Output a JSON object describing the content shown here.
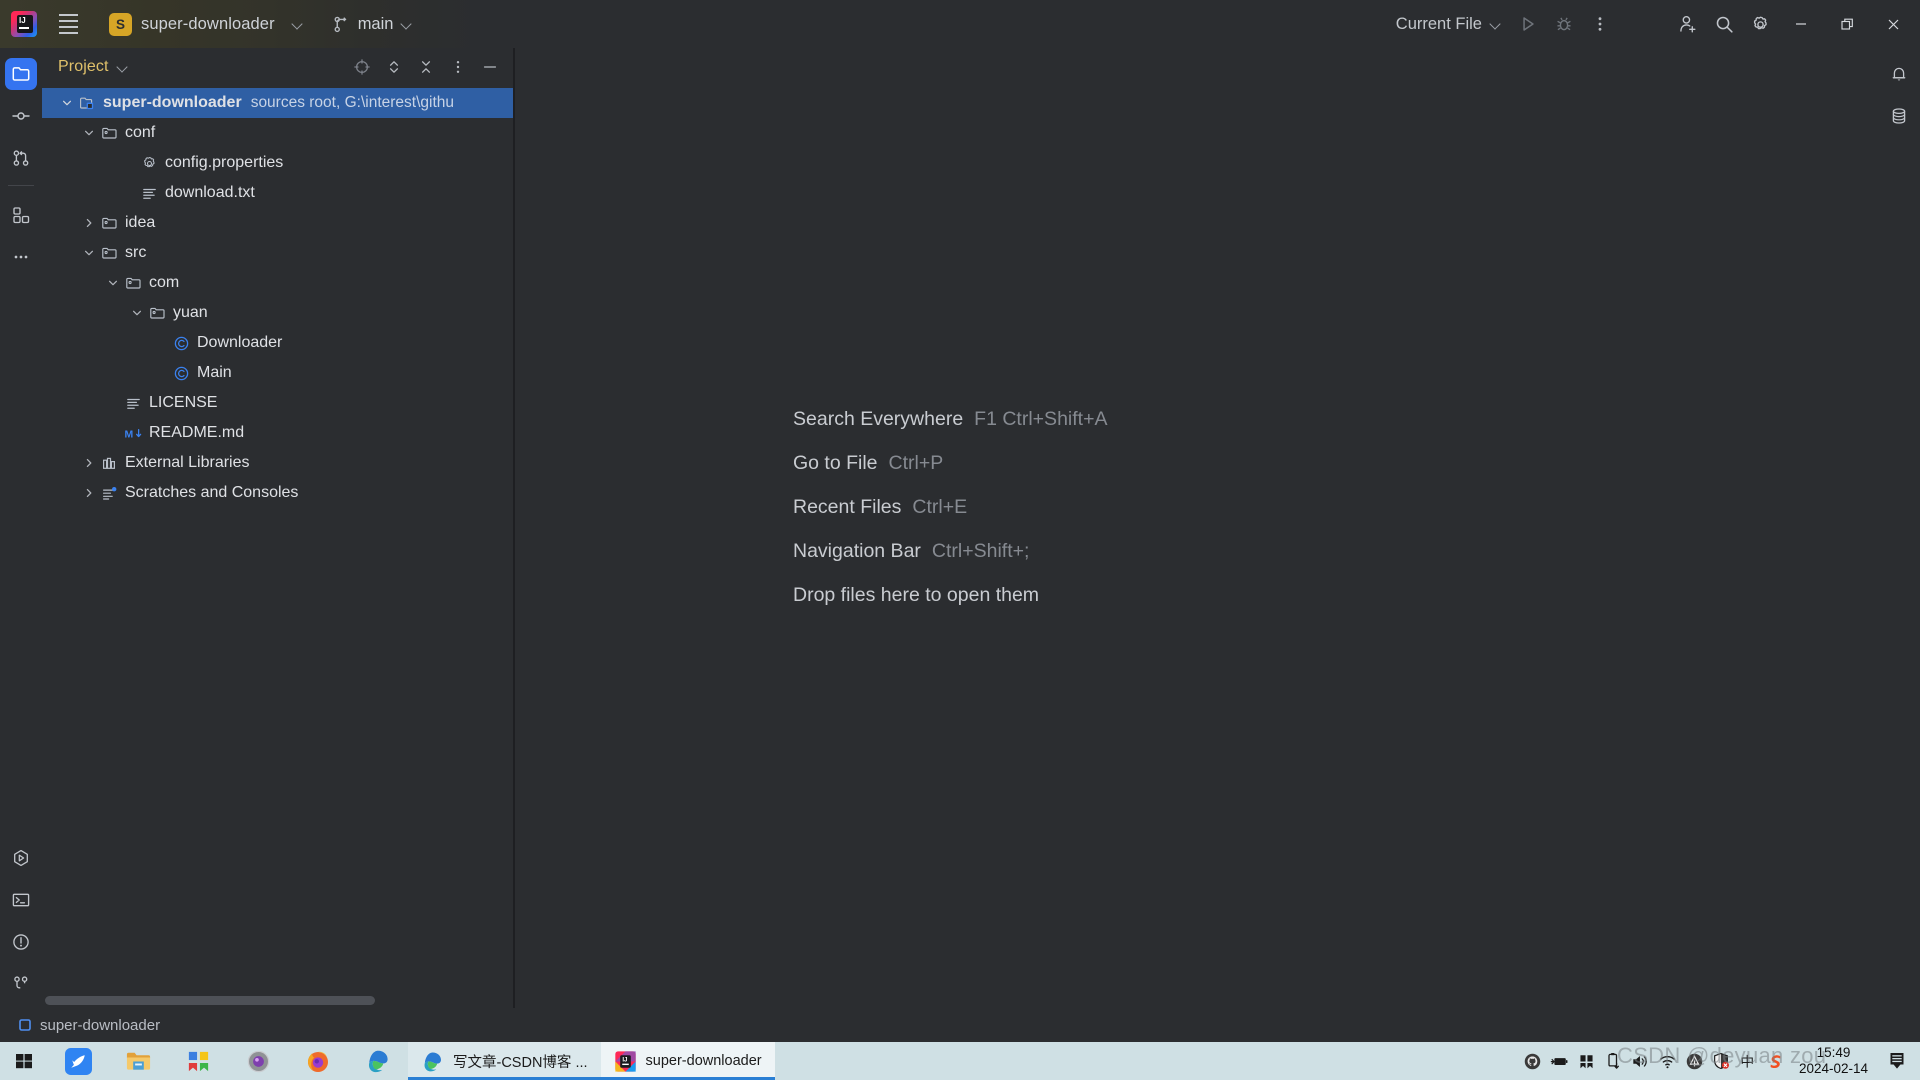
{
  "titlebar": {
    "logo_icon": "intellij-idea-logo",
    "menu_icon": "hamburger-menu-icon",
    "project_badge": "S",
    "project_name": "super-downloader",
    "project_chevron_icon": "chevron-down-icon",
    "branch_icon": "git-branch-icon",
    "branch_name": "main",
    "branch_chevron_icon": "chevron-down-icon",
    "run_config": "Current File",
    "run_config_chevron_icon": "chevron-down-icon",
    "run_icon": "run-play-icon",
    "debug_icon": "debug-bug-icon",
    "more_icon": "more-vertical-icon",
    "account_icon": "user-add-icon",
    "search_icon": "search-icon",
    "settings_icon": "gear-icon",
    "minimize_icon": "minimize-icon",
    "maximize_icon": "maximize-restore-icon",
    "close_icon": "close-icon"
  },
  "left_toolbar": {
    "items": [
      {
        "name": "project",
        "icon": "folder-icon",
        "selected": true
      },
      {
        "name": "commit",
        "icon": "commit-icon",
        "selected": false
      },
      {
        "name": "pull-requests",
        "icon": "pull-request-icon",
        "selected": false
      },
      {
        "name": "plugins",
        "icon": "squares-icon",
        "selected": false
      },
      {
        "name": "more-tool-windows",
        "icon": "more-horizontal-icon",
        "selected": false
      }
    ],
    "bottom_items": [
      {
        "name": "run",
        "icon": "run-hexagon-icon"
      },
      {
        "name": "terminal",
        "icon": "terminal-icon"
      },
      {
        "name": "problems",
        "icon": "warning-circle-icon"
      },
      {
        "name": "version-control",
        "icon": "git-branch-icon"
      }
    ]
  },
  "right_toolbar": {
    "items": [
      {
        "name": "notifications",
        "icon": "bell-icon"
      },
      {
        "name": "database",
        "icon": "database-icon"
      }
    ]
  },
  "project_panel": {
    "title": "Project",
    "title_chevron_icon": "chevron-down-icon",
    "actions": [
      {
        "name": "select-opened-file",
        "icon": "crosshair-icon"
      },
      {
        "name": "expand-collapse",
        "icon": "up-down-arrows-icon"
      },
      {
        "name": "collapse-all",
        "icon": "collapse-all-icon"
      },
      {
        "name": "options-menu",
        "icon": "more-vertical-icon"
      },
      {
        "name": "hide-panel",
        "icon": "minus-icon"
      }
    ],
    "tree": [
      {
        "name": "super-downloader",
        "meta": "sources root,  G:\\interest\\githu",
        "indent": 0,
        "twist": "down",
        "icon": "module-folder-icon",
        "bold": true,
        "selected": true
      },
      {
        "name": "conf",
        "meta": "",
        "indent": 1,
        "twist": "down",
        "icon": "folder-icon",
        "bold": false,
        "selected": false
      },
      {
        "name": "config.properties",
        "meta": "",
        "indent": 2,
        "twist": "none",
        "icon": "properties-file-icon",
        "bold": false,
        "selected": false
      },
      {
        "name": "download.txt",
        "meta": "",
        "indent": 2,
        "twist": "none",
        "icon": "text-file-icon",
        "bold": false,
        "selected": false
      },
      {
        "name": "idea",
        "meta": "",
        "indent": 1,
        "twist": "right",
        "icon": "folder-icon",
        "bold": false,
        "selected": false
      },
      {
        "name": "src",
        "meta": "",
        "indent": 1,
        "twist": "down",
        "icon": "folder-icon",
        "bold": false,
        "selected": false
      },
      {
        "name": "com",
        "meta": "",
        "indent": 2,
        "twist": "down",
        "icon": "folder-icon",
        "bold": false,
        "selected": false
      },
      {
        "name": "yuan",
        "meta": "",
        "indent": 3,
        "twist": "down",
        "icon": "folder-icon",
        "bold": false,
        "selected": false
      },
      {
        "name": "Downloader",
        "meta": "",
        "indent": 4,
        "twist": "none",
        "icon": "java-class-icon",
        "bold": false,
        "selected": false
      },
      {
        "name": "Main",
        "meta": "",
        "indent": 4,
        "twist": "none",
        "icon": "java-class-icon",
        "bold": false,
        "selected": false
      },
      {
        "name": "LICENSE",
        "meta": "",
        "indent": 2,
        "twist": "none",
        "icon": "text-file-icon",
        "bold": false,
        "selected": false
      },
      {
        "name": "README.md",
        "meta": "",
        "indent": 2,
        "twist": "none",
        "icon": "markdown-file-icon",
        "bold": false,
        "selected": false
      },
      {
        "name": "External Libraries",
        "meta": "",
        "indent": 1,
        "twist": "right",
        "icon": "libraries-icon",
        "bold": false,
        "selected": false
      },
      {
        "name": "Scratches and Consoles",
        "meta": "",
        "indent": 1,
        "twist": "right",
        "icon": "scratches-icon",
        "bold": false,
        "selected": false
      }
    ]
  },
  "editor": {
    "hints": [
      {
        "action": "Search Everywhere",
        "keys": "F1 Ctrl+Shift+A"
      },
      {
        "action": "Go to File",
        "keys": "Ctrl+P"
      },
      {
        "action": "Recent Files",
        "keys": "Ctrl+E"
      },
      {
        "action": "Navigation Bar",
        "keys": "Ctrl+Shift+;"
      },
      {
        "action": "Drop files here to open them",
        "keys": ""
      }
    ]
  },
  "statusbar": {
    "project_icon": "module-square-icon",
    "project_label": "super-downloader"
  },
  "taskbar": {
    "start_icon": "windows-start-icon",
    "pinned": [
      {
        "name": "mail-bird",
        "icon": "blue-bird-icon"
      },
      {
        "name": "file-explorer",
        "icon": "folder-explorer-icon"
      },
      {
        "name": "microsoft-store",
        "icon": "store-icon"
      },
      {
        "name": "unity-hub",
        "icon": "sphere-icon"
      },
      {
        "name": "firefox",
        "icon": "firefox-icon"
      },
      {
        "name": "edge-pinned",
        "icon": "edge-icon"
      }
    ],
    "windows": [
      {
        "name": "edge-window",
        "icon": "edge-icon",
        "label": "写文章-CSDN博客 ...",
        "active": false
      },
      {
        "name": "intellij-window",
        "icon": "intellij-idea-logo",
        "label": "super-downloader",
        "active": true
      }
    ],
    "tray": [
      {
        "name": "github-tray",
        "icon": "github-cat-icon"
      },
      {
        "name": "battery",
        "icon": "battery-charging-icon"
      },
      {
        "name": "store-tray",
        "icon": "store-icon"
      },
      {
        "name": "usb-eject",
        "icon": "usb-eject-icon"
      },
      {
        "name": "volume",
        "icon": "speaker-icon"
      },
      {
        "name": "network",
        "icon": "wifi-icon"
      },
      {
        "name": "nvidia",
        "icon": "nvidia-icon"
      },
      {
        "name": "security",
        "icon": "shield-warning-icon"
      },
      {
        "name": "ime-chinese",
        "icon": "ime-chinese-icon"
      },
      {
        "name": "sogou-input",
        "icon": "sogou-icon"
      }
    ],
    "clock_time": "15:49",
    "clock_date": "2024-02-14",
    "notification_icon": "action-center-icon"
  },
  "watermark": "CSDN @deyuan zou",
  "colors": {
    "titlebar_accent": "#3a3a2c",
    "panel_bg": "#2b2d30",
    "editor_bg": "#2b2d30",
    "selection_blue": "#2f5fa4",
    "accent_blue": "#3574f0",
    "project_title": "#dfc06a",
    "taskbar_bg": "#cfe0e4"
  }
}
